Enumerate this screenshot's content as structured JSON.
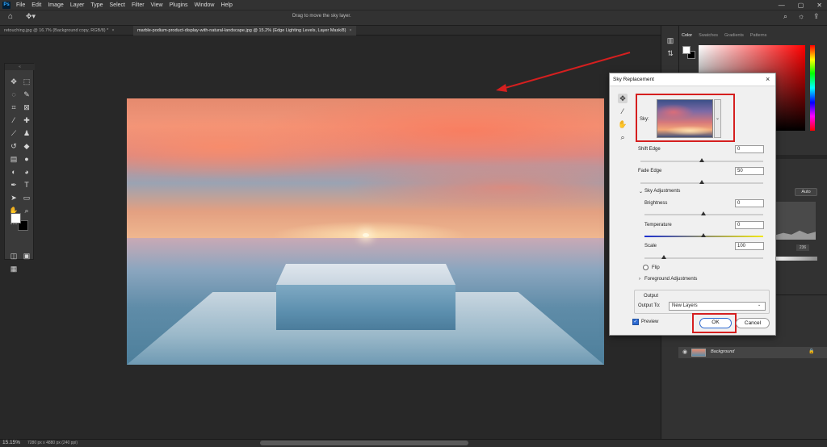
{
  "app": {
    "logo": "Ps",
    "menu": [
      "File",
      "Edit",
      "Image",
      "Layer",
      "Type",
      "Select",
      "Filter",
      "View",
      "Plugins",
      "Window",
      "Help"
    ],
    "window_controls": [
      "—",
      "▢",
      "✕"
    ]
  },
  "options_bar": {
    "hint": "Drag to move the sky layer."
  },
  "document_tabs": [
    {
      "label": "retouching.jpg @ 16.7% (Background copy, RGB/8) *",
      "active": false
    },
    {
      "label": "marble-podium-product-display-with-natural-landscape.jpg @ 15.2% (Edge Lighting Levels, Layer Mask/8)",
      "active": true
    }
  ],
  "right_panel": {
    "color_tabs": [
      "Color",
      "Swatches",
      "Gradients",
      "Patterns"
    ],
    "auto_label": "Auto",
    "level_value": "236",
    "layer_name": "Background"
  },
  "status_bar": {
    "zoom": "15.15%",
    "doc_size": "7280 px x 4880 px (240 ppi)"
  },
  "dialog": {
    "title": "Sky Replacement",
    "sky_label": "Sky:",
    "shift_edge_label": "Shift Edge",
    "shift_edge_value": "0",
    "fade_edge_label": "Fade Edge",
    "fade_edge_value": "50",
    "sky_adjustments_label": "Sky Adjustments",
    "brightness_label": "Brightness",
    "brightness_value": "0",
    "temperature_label": "Temperature",
    "temperature_value": "0",
    "scale_label": "Scale",
    "scale_value": "100",
    "flip_label": "Flip",
    "foreground_adjustments_label": "Foreground Adjustments",
    "output_group_label": "Output",
    "output_to_label": "Output To:",
    "output_to_value": "New Layers",
    "preview_label": "Preview",
    "ok_label": "OK",
    "cancel_label": "Cancel"
  },
  "colors": {
    "annotation_red": "#d51f1f",
    "accent_blue": "#2d6ad1"
  }
}
